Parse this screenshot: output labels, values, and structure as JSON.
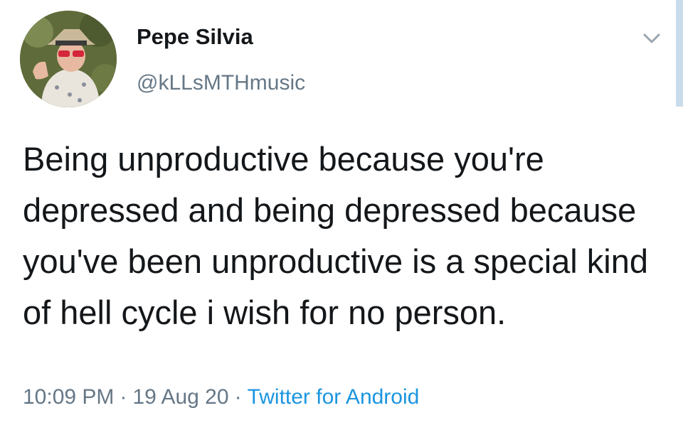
{
  "tweet": {
    "display_name": "Pepe Silvia",
    "handle": "@kLLsMTHmusic",
    "text": "Being unproductive because you're depressed and being depressed because you've been unproductive is a special kind of hell cycle i wish for no person.",
    "time": "10:09 PM",
    "separator": "·",
    "date": "19 Aug 20",
    "source": "Twitter for Android",
    "avatar_icon": "profile-photo-avatar",
    "menu_icon": "chevron-down-icon"
  },
  "colors": {
    "text": "#14171a",
    "secondary": "#657786",
    "link": "#1b95e0",
    "scrollbar": "#c9dcec"
  }
}
